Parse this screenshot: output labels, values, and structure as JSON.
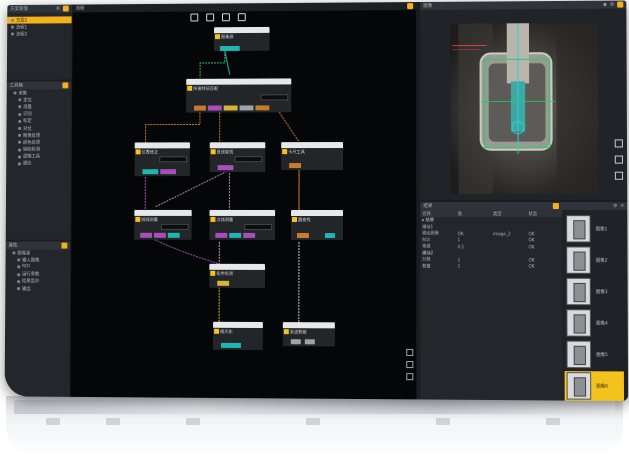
{
  "panels": {
    "scheme": {
      "title": "方案管理",
      "items": [
        {
          "label": "方案1",
          "selected": true
        },
        {
          "label": "流程1",
          "selected": false
        },
        {
          "label": "流程2",
          "selected": false
        }
      ]
    },
    "toolbox": {
      "title": "工具箱",
      "items": [
        {
          "label": "采集",
          "indent": false
        },
        {
          "label": "定位",
          "indent": true
        },
        {
          "label": "测量",
          "indent": true
        },
        {
          "label": "识别",
          "indent": true
        },
        {
          "label": "标定",
          "indent": true
        },
        {
          "label": "对位",
          "indent": true
        },
        {
          "label": "图像处理",
          "indent": true
        },
        {
          "label": "颜色处理",
          "indent": true
        },
        {
          "label": "缺陷检测",
          "indent": true
        },
        {
          "label": "逻辑工具",
          "indent": true
        },
        {
          "label": "通信",
          "indent": true
        }
      ]
    },
    "properties": {
      "title": "属性",
      "items": [
        {
          "label": "图像源",
          "indent": false
        },
        {
          "label": "输入图像",
          "indent": true
        },
        {
          "label": "ROI",
          "indent": true
        },
        {
          "label": "运行参数",
          "indent": true
        },
        {
          "label": "结果显示",
          "indent": true
        },
        {
          "label": "输出",
          "indent": true
        }
      ]
    },
    "flow": {
      "title": "流程"
    },
    "image": {
      "title": "图像"
    },
    "results": {
      "title": "结果",
      "columns": [
        "名称",
        "值",
        "类型",
        "状态"
      ],
      "rows": [
        {
          "cells": [
            "▸ 结果",
            "",
            "",
            ""
          ],
          "group": true
        },
        {
          "cells": [
            "  模块1",
            "",
            "",
            ""
          ],
          "group": false
        },
        {
          "cells": [
            "    输出图像",
            "OK",
            "image_2",
            "OK"
          ],
          "group": false
        },
        {
          "cells": [
            "    ROI",
            "1",
            "",
            "OK"
          ],
          "group": false
        },
        {
          "cells": [
            "    角度",
            "0.1",
            "",
            "OK"
          ],
          "group": false
        },
        {
          "cells": [
            "  模块2",
            "",
            "",
            ""
          ],
          "group": true
        },
        {
          "cells": [
            "    分数",
            "1",
            "",
            "OK"
          ],
          "group": false
        },
        {
          "cells": [
            "    数量",
            "1",
            "",
            "OK"
          ],
          "group": false
        }
      ]
    }
  },
  "nodes": [
    {
      "id": "n0",
      "title": "图像源"
    },
    {
      "id": "n1",
      "title": "快速特征匹配"
    },
    {
      "id": "n2",
      "title": "位置修正"
    },
    {
      "id": "n3",
      "title": "直线查找"
    },
    {
      "id": "n4",
      "title": "卡尺工具"
    },
    {
      "id": "n5",
      "title": "线线测量"
    },
    {
      "id": "n6",
      "title": "点线测量"
    },
    {
      "id": "n7",
      "title": "圆查找"
    },
    {
      "id": "n8",
      "title": "条件检测"
    },
    {
      "id": "n9",
      "title": "格式化"
    },
    {
      "id": "n10",
      "title": "发送数据"
    }
  ],
  "thumbnails": [
    {
      "label": "图像1",
      "active": false
    },
    {
      "label": "图像2",
      "active": false
    },
    {
      "label": "图像3",
      "active": false
    },
    {
      "label": "图像4",
      "active": false
    },
    {
      "label": "图像5",
      "active": false
    },
    {
      "label": "图像6",
      "active": true
    }
  ],
  "colors": {
    "accent": "#f4c21d",
    "background": "#1b1d21",
    "canvas": "#050607"
  }
}
